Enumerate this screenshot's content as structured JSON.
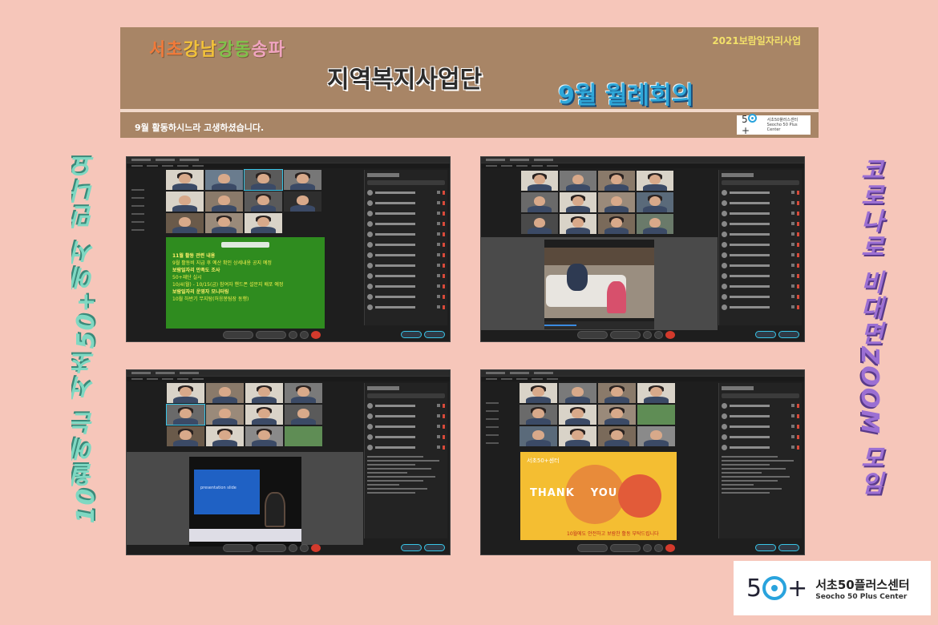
{
  "banner": {
    "regions": [
      "서초",
      "강남",
      "강동",
      "송파"
    ],
    "region_colors": [
      "#f07a3a",
      "#f2c23a",
      "#7fc24a",
      "#f0a4c0"
    ],
    "year_label": "2021보람일자리사업",
    "main_title": "지역복지사업단",
    "meeting_title": "9월 월례회의",
    "thanks_text": "9월 활동하시느라 고생하셨습니다.",
    "mini_logo": {
      "mark": "50",
      "plus": "+",
      "text_ko": "서초50플러스센터",
      "text_en": "Seocho 50 Plus Center"
    }
  },
  "side_text": {
    "left": "10월에는 서초50+에서 만나요",
    "right": "코로나로 비대면ZOOM 모임"
  },
  "shots": {
    "shot1": {
      "slide_lines": [
        {
          "text": "11월 활동 관련 내용",
          "heading": true
        },
        {
          "text": "9월 활동비 지급 후 예산 확인 상세내용 공지 예정",
          "heading": false
        },
        {
          "text": " ",
          "heading": false
        },
        {
          "text": "보람일자리 만족도 조사",
          "heading": true
        },
        {
          "text": "50+재단 실시",
          "heading": false
        },
        {
          "text": "10/4(월) - 10/15(금) 참여자 핸드폰 설문지 배포 예정",
          "heading": false
        },
        {
          "text": " ",
          "heading": false
        },
        {
          "text": "보람일자리 운영자 모니터링",
          "heading": true
        },
        {
          "text": "10월 하반기 무지탐(허응봉팀장 동행)",
          "heading": false
        }
      ]
    },
    "shot4": {
      "org": "서초50+센터",
      "thank": "THANK",
      "you": "YOU",
      "message": "10월에도 안전하고 보람찬 활동 부탁드립니다"
    }
  },
  "logo": {
    "mark_left": "5",
    "plus": "+",
    "name_ko": "서초50플러스센터",
    "name_en": "Seocho 50 Plus Center"
  }
}
